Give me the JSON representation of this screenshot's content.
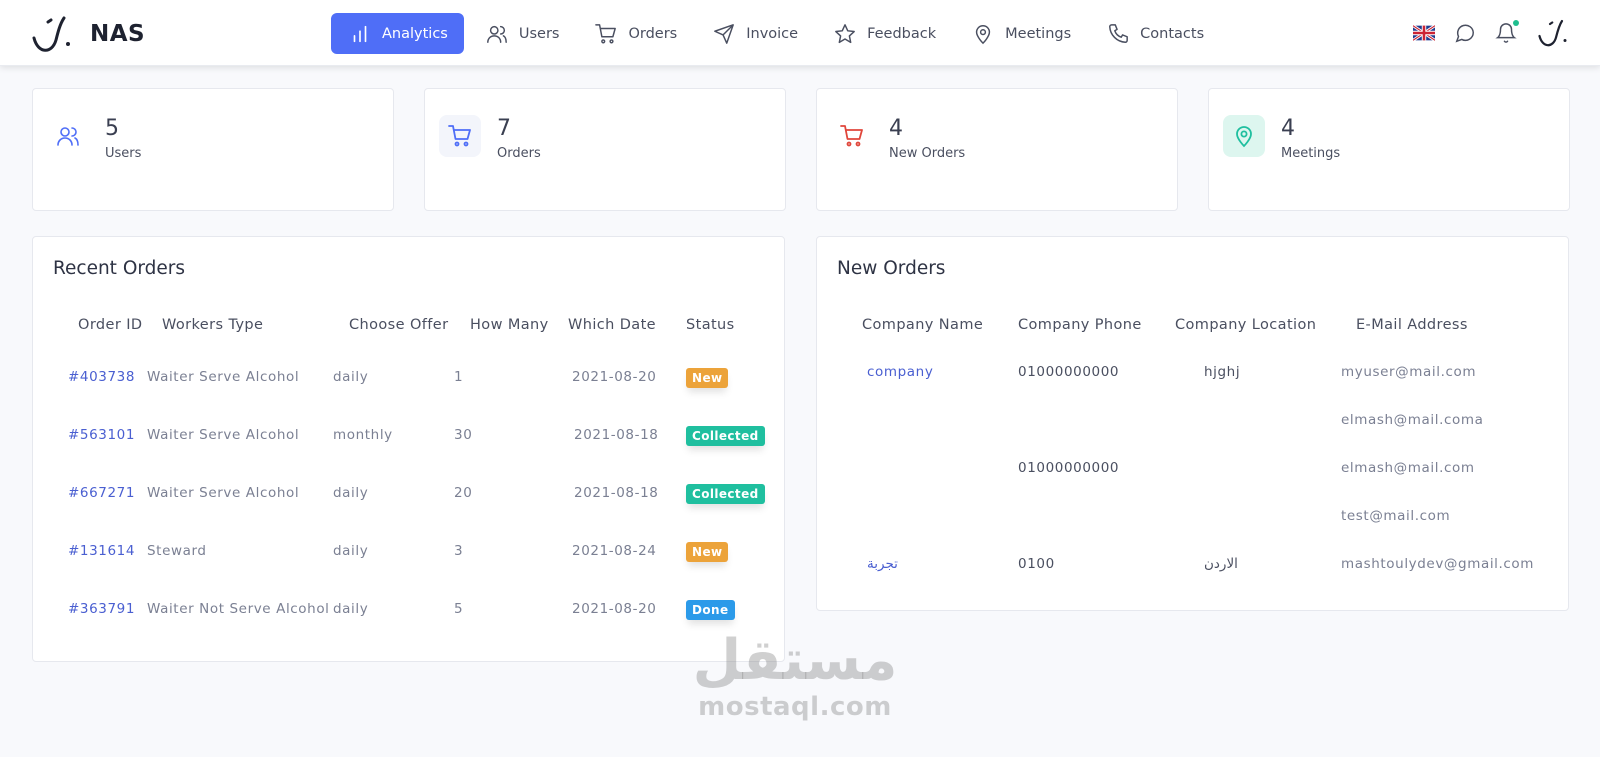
{
  "header": {
    "brand_name": "NAS",
    "nav": [
      {
        "label": "Analytics",
        "icon": "bar-chart-icon",
        "active": true
      },
      {
        "label": "Users",
        "icon": "users-icon",
        "active": false
      },
      {
        "label": "Orders",
        "icon": "cart-icon",
        "active": false
      },
      {
        "label": "Invoice",
        "icon": "send-icon",
        "active": false
      },
      {
        "label": "Feedback",
        "icon": "star-icon",
        "active": false
      },
      {
        "label": "Meetings",
        "icon": "map-pin-icon",
        "active": false
      },
      {
        "label": "Contacts",
        "icon": "phone-icon",
        "active": false
      }
    ],
    "right_icons": [
      "uk-flag-icon",
      "chat-icon",
      "bell-icon",
      "avatar-logo-icon"
    ]
  },
  "stats": [
    {
      "value": "5",
      "label": "Users",
      "icon": "users-icon",
      "color": "#4f6ef7"
    },
    {
      "value": "7",
      "label": "Orders",
      "icon": "cart-icon",
      "color": "#4f6ef7"
    },
    {
      "value": "4",
      "label": "New Orders",
      "icon": "cart-icon",
      "color": "#e0463b"
    },
    {
      "value": "4",
      "label": "Meetings",
      "icon": "map-pin-icon",
      "color": "#1fbf9f"
    }
  ],
  "recent_orders": {
    "title": "Recent Orders",
    "columns": [
      "Order ID",
      "Workers Type",
      "Choose Offer",
      "How Many",
      "Which Date",
      "Status"
    ],
    "rows": [
      {
        "id": "#403738",
        "type": "Waiter Serve Alcohol",
        "offer": "daily",
        "count": "1",
        "date": "2021-08-20",
        "status": "New",
        "status_kind": "new"
      },
      {
        "id": "#563101",
        "type": "Waiter Serve Alcohol",
        "offer": "monthly",
        "count": "30",
        "date": "2021-08-18",
        "status": "Collected",
        "status_kind": "collected"
      },
      {
        "id": "#667271",
        "type": "Waiter Serve Alcohol",
        "offer": "daily",
        "count": "20",
        "date": "2021-08-18",
        "status": "Collected",
        "status_kind": "collected"
      },
      {
        "id": "#131614",
        "type": "Steward",
        "offer": "daily",
        "count": "3",
        "date": "2021-08-24",
        "status": "New",
        "status_kind": "new"
      },
      {
        "id": "#363791",
        "type": "Waiter Not Serve Alcohol",
        "offer": "daily",
        "count": "5",
        "date": "2021-08-20",
        "status": "Done",
        "status_kind": "done"
      }
    ]
  },
  "new_orders": {
    "title": "New Orders",
    "columns": [
      "Company Name",
      "Company Phone",
      "Company Location",
      "E-Mail Address"
    ],
    "rows": [
      {
        "name": "company",
        "phone": "01000000000",
        "location": "hjghj",
        "email": "myuser@mail.com"
      },
      {
        "name": "",
        "phone": "",
        "location": "",
        "email": "elmash@mail.coma"
      },
      {
        "name": "",
        "phone": "01000000000",
        "location": "",
        "email": "elmash@mail.com"
      },
      {
        "name": "",
        "phone": "",
        "location": "",
        "email": "test@mail.com"
      },
      {
        "name": "تجربة",
        "phone": "0100",
        "location": "الاردن",
        "email": "mashtoulydev@gmail.com"
      }
    ]
  },
  "watermark": {
    "arabic": "مستقل",
    "latin": "mostaql.com"
  },
  "colors": {
    "accent": "#4f6ef7",
    "new": "#eca33a",
    "collected": "#1fbf9f",
    "done": "#2b9ae9"
  }
}
